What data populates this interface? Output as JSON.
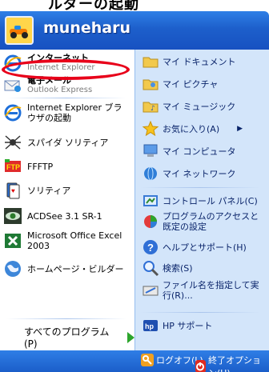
{
  "top": {
    "cutoff_text": "ルダーの起動"
  },
  "header": {
    "username": "muneharu"
  },
  "left": {
    "pinned": [
      {
        "label": "インターネット",
        "sub": "Internet Explorer",
        "icon": "internet-explorer-icon"
      },
      {
        "label": "電子メール",
        "sub": "Outlook Express",
        "icon": "email-icon"
      }
    ],
    "recent": [
      {
        "label": "Internet Explorer ブラウザの起動",
        "icon": "internet-explorer-icon"
      },
      {
        "label": "スパイダ ソリティア",
        "icon": "spider-icon"
      },
      {
        "label": "FFFTP",
        "icon": "ftp-icon"
      },
      {
        "label": "ソリティア",
        "icon": "cards-icon"
      },
      {
        "label": "ACDSee 3.1 SR-1",
        "icon": "eye-icon"
      },
      {
        "label": "Microsoft Office Excel 2003",
        "icon": "excel-icon"
      },
      {
        "label": "ホームページ・ビルダー",
        "icon": "globe-icon"
      }
    ],
    "all_programs": "すべてのプログラム(P)"
  },
  "right": {
    "items": [
      {
        "label": "マイ ドキュメント",
        "icon": "folder-icon"
      },
      {
        "label": "マイ ピクチャ",
        "icon": "folder-pictures-icon"
      },
      {
        "label": "マイ ミュージック",
        "icon": "folder-music-icon"
      },
      {
        "label": "お気に入り(A)",
        "icon": "star-icon",
        "arrow": "▶"
      },
      {
        "label": "マイ コンピュータ",
        "icon": "computer-icon"
      },
      {
        "label": "マイ ネットワーク",
        "icon": "network-icon"
      },
      {
        "label": "コントロール パネル(C)",
        "icon": "control-panel-icon"
      },
      {
        "label": "プログラムのアクセスと既定の設定",
        "icon": "program-defaults-icon"
      },
      {
        "label": "ヘルプとサポート(H)",
        "icon": "help-icon"
      },
      {
        "label": "検索(S)",
        "icon": "search-icon"
      },
      {
        "label": "ファイル名を指定して実行(R)...",
        "icon": "run-icon"
      },
      {
        "label": "HP サポート",
        "icon": "hp-icon"
      }
    ]
  },
  "footer": {
    "logoff": "ログオフ(L)",
    "shutdown": "終了オプション(U)"
  }
}
